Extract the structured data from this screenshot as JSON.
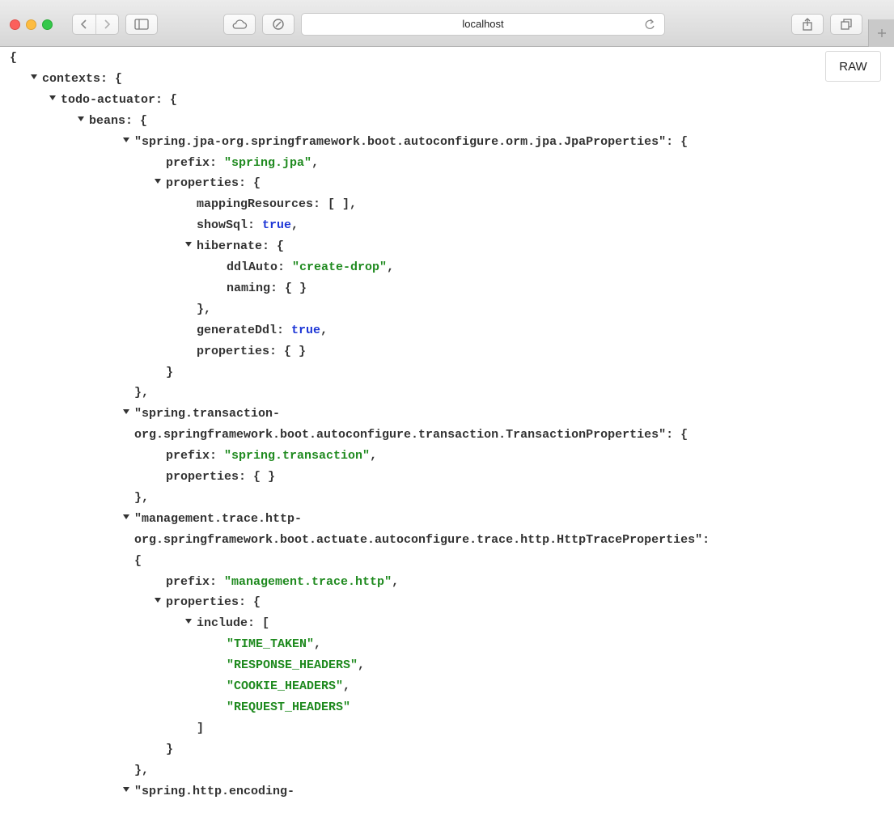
{
  "browser": {
    "address": "localhost"
  },
  "viewer": {
    "raw_label": "RAW",
    "lines": [
      {
        "text": "{"
      },
      {
        "caret": true,
        "key": "contexts",
        "tail": "{"
      },
      {
        "caret": true,
        "key": "todo-actuator",
        "tail": "{"
      },
      {
        "caret": true,
        "key": "beans",
        "tail": "{"
      },
      {
        "caret": true,
        "text": "\"spring.jpa-org.springframework.boot.autoconfigure.orm.jpa.JpaProperties\": {"
      },
      {
        "key": "prefix",
        "string": "\"spring.jpa\"",
        "tail": ","
      },
      {
        "caret": true,
        "key": "properties",
        "tail": "{"
      },
      {
        "key": "mappingResources",
        "tail": "[ ],"
      },
      {
        "key": "showSql",
        "bool": "true",
        "tail": ","
      },
      {
        "caret": true,
        "key": "hibernate",
        "tail": "{"
      },
      {
        "key": "ddlAuto",
        "string": "\"create-drop\"",
        "tail": ","
      },
      {
        "key": "naming",
        "tail": "{ }"
      },
      {
        "text": "},"
      },
      {
        "key": "generateDdl",
        "bool": "true",
        "tail": ","
      },
      {
        "key": "properties",
        "tail": "{ }"
      },
      {
        "text": "}"
      },
      {
        "text": "},"
      },
      {
        "caret": true,
        "text": "\"spring.transaction-"
      },
      {
        "text": "org.springframework.boot.autoconfigure.transaction.TransactionProperties\": {"
      },
      {
        "key": "prefix",
        "string": "\"spring.transaction\"",
        "tail": ","
      },
      {
        "key": "properties",
        "tail": "{ }"
      },
      {
        "text": "},"
      },
      {
        "caret": true,
        "text": "\"management.trace.http-"
      },
      {
        "text": "org.springframework.boot.actuate.autoconfigure.trace.http.HttpTraceProperties\":"
      },
      {
        "text": "{"
      },
      {
        "key": "prefix",
        "string": "\"management.trace.http\"",
        "tail": ","
      },
      {
        "caret": true,
        "key": "properties",
        "tail": "{"
      },
      {
        "caret": true,
        "key": "include",
        "tail": "["
      },
      {
        "string": "\"TIME_TAKEN\"",
        "tail": ","
      },
      {
        "string": "\"RESPONSE_HEADERS\"",
        "tail": ","
      },
      {
        "string": "\"COOKIE_HEADERS\"",
        "tail": ","
      },
      {
        "string": "\"REQUEST_HEADERS\""
      },
      {
        "text": "]"
      },
      {
        "text": "}"
      },
      {
        "text": "},"
      },
      {
        "caret": true,
        "text": "\"spring.http.encoding-"
      }
    ]
  }
}
